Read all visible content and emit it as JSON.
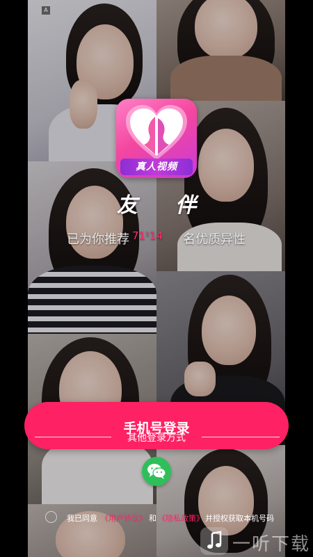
{
  "app": {
    "logo_caption": "真人视频",
    "brand_name": "友 伴",
    "tagline_prefix": "已为你推荐",
    "tagline_count": "71¹14",
    "tagline_suffix": "名优质异性"
  },
  "login": {
    "phone_login_label": "手机号登录",
    "other_methods_label": "其他登录方式",
    "wechat_icon": "wechat-icon"
  },
  "agreement": {
    "prefix": "我已同意",
    "user_agreement": "《用户协议》",
    "and": "和",
    "privacy_policy": "《隐私政策》",
    "suffix": "并授权获取本机号码"
  },
  "watermark": {
    "text": "一听下载"
  },
  "colors": {
    "accent": "#fe2163",
    "wechat": "#2fbf5a",
    "logo_gradient_start": "#ff7fc6",
    "logo_gradient_end": "#c93ad8"
  }
}
